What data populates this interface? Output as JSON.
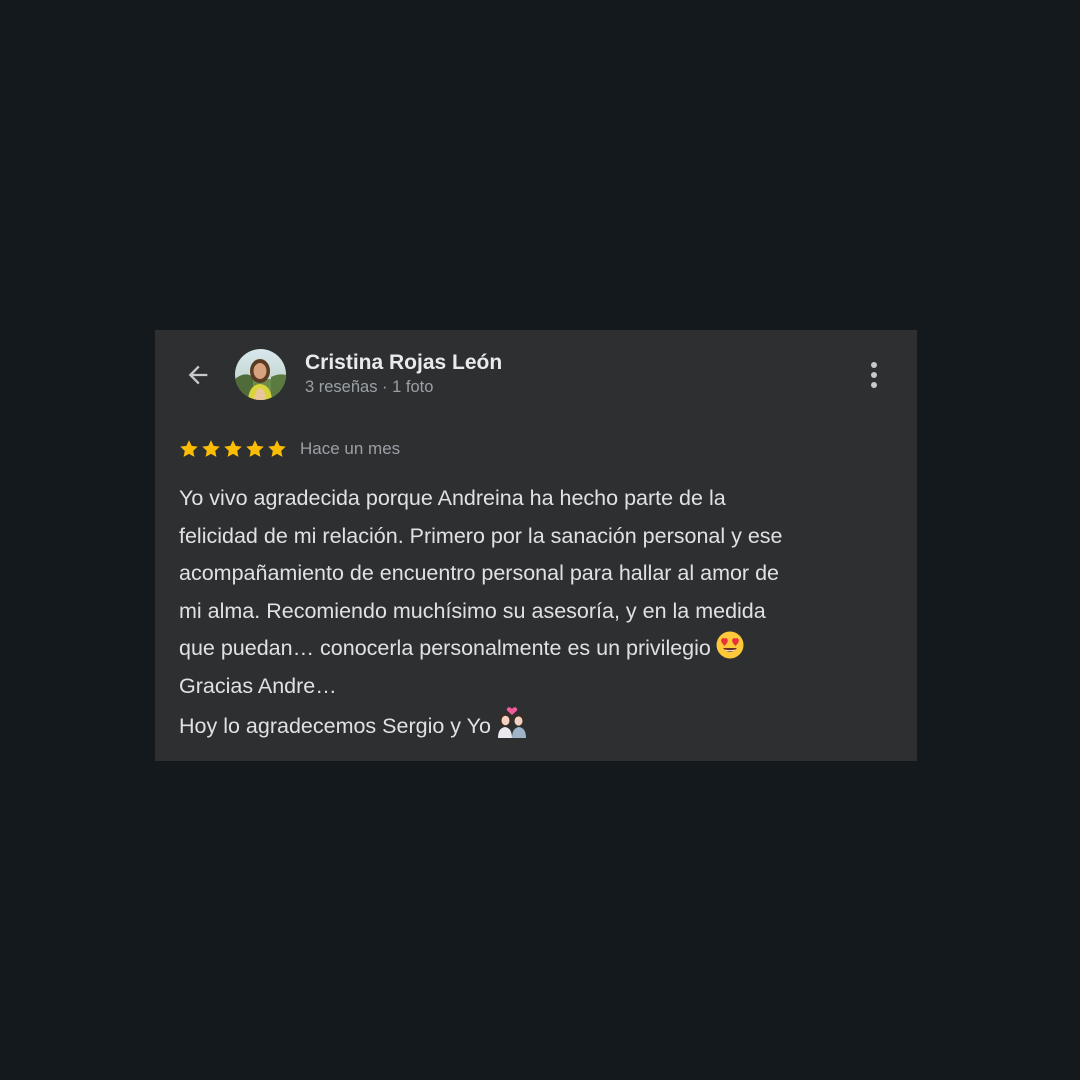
{
  "reviewer": {
    "name": "Cristina Rojas León",
    "meta": "3 reseñas · 1 foto"
  },
  "review": {
    "rating": 5,
    "max_rating": 5,
    "date": "Hace un mes",
    "lines": [
      "Yo vivo agradecida porque Andreina ha hecho parte de la",
      "felicidad de mi relación. Primero por la sanación personal y ese",
      "acompañamiento de encuentro personal para hallar al amor de",
      "mi alma. Recomiendo muchísimo su asesoría, y en la medida",
      "que puedan… conocerla personalmente es un privilegio",
      "Gracias Andre…",
      "Hoy lo agradecemos Sergio y Yo"
    ]
  },
  "icons": {
    "back": "arrow-left-icon",
    "more": "more-vertical-icon",
    "star": "star-icon",
    "emoji_1": "heart-eyes-emoji",
    "emoji_2": "couple-with-heart-emoji"
  },
  "colors": {
    "page_background": "#13191c",
    "card_background": "#2e2f31",
    "star": "#fbbc04",
    "name_text": "#e8eaed",
    "secondary_text": "#9aa0a6",
    "body_text": "#dfe1e5"
  }
}
